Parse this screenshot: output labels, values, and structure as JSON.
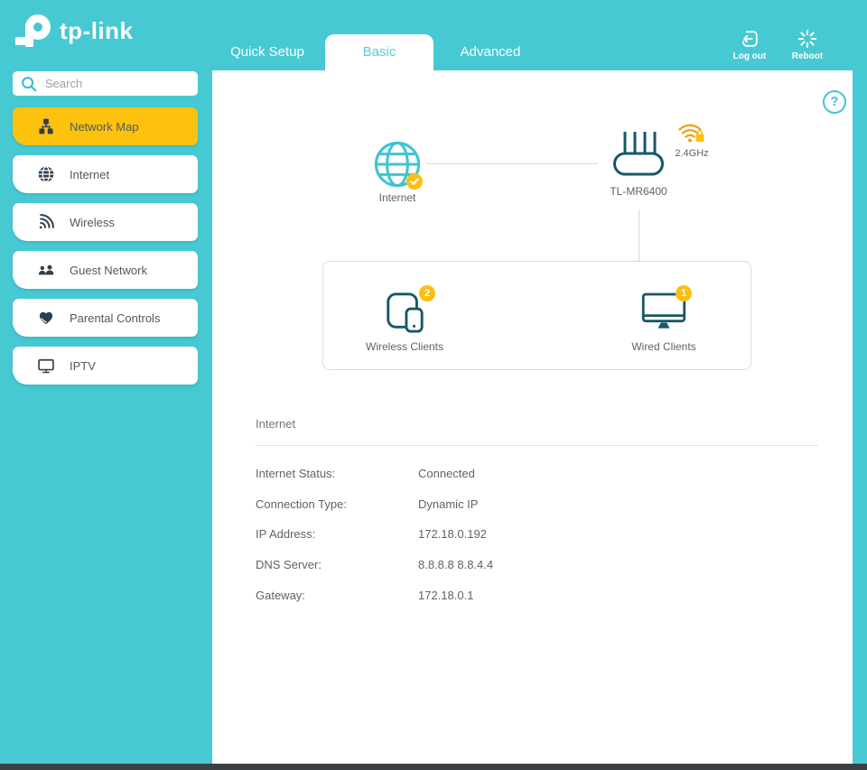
{
  "brand": {
    "name": "tp-link"
  },
  "header": {
    "tabs": [
      {
        "label": "Quick Setup",
        "active": false
      },
      {
        "label": "Basic",
        "active": true
      },
      {
        "label": "Advanced",
        "active": false
      }
    ],
    "actions": [
      {
        "label": "Log out",
        "icon": "logout-icon"
      },
      {
        "label": "Reboot",
        "icon": "reboot-icon"
      }
    ]
  },
  "sidebar": {
    "search": {
      "placeholder": "Search"
    },
    "items": [
      {
        "label": "Network Map",
        "icon": "network-map-icon",
        "active": true
      },
      {
        "label": "Internet",
        "icon": "globe-icon",
        "active": false
      },
      {
        "label": "Wireless",
        "icon": "wireless-icon",
        "active": false
      },
      {
        "label": "Guest Network",
        "icon": "guest-network-icon",
        "active": false
      },
      {
        "label": "Parental Controls",
        "icon": "parental-controls-icon",
        "active": false
      },
      {
        "label": "IPTV",
        "icon": "iptv-icon",
        "active": false
      }
    ]
  },
  "network_map": {
    "internet_node": {
      "label": "Internet",
      "status": "connected"
    },
    "router_node": {
      "label": "TL-MR6400",
      "wifi_band": "2.4GHz"
    },
    "clients": [
      {
        "label": "Wireless Clients",
        "count": "2"
      },
      {
        "label": "Wired Clients",
        "count": "1"
      }
    ]
  },
  "details": {
    "title": "Internet",
    "rows": [
      {
        "label": "Internet Status:",
        "value": "Connected"
      },
      {
        "label": "Connection Type:",
        "value": "Dynamic IP"
      },
      {
        "label": "IP Address:",
        "value": "172.18.0.192"
      },
      {
        "label": "DNS Server:",
        "value": "8.8.8.8 8.8.4.4"
      },
      {
        "label": "Gateway:",
        "value": "172.18.0.1"
      }
    ]
  },
  "help": {
    "glyph": "?"
  },
  "colors": {
    "teal": "#47c9d3",
    "active_tab_text": "#55cbd7",
    "yellow": "#fdc20e",
    "badge_yellow": "#fcbf11",
    "dark_teal_icon": "#175866",
    "sidebar_icon": "#2e4050",
    "wifi_orange": "#f4a01d",
    "text_gray": "#5f6368",
    "bottom_bar": "#3b4045"
  }
}
